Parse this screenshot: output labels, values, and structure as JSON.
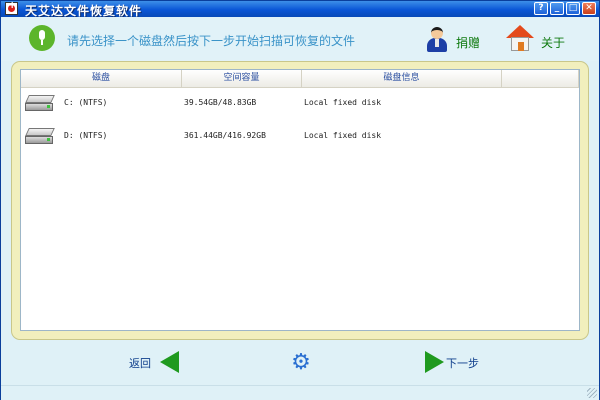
{
  "window": {
    "title": "天艾达文件恢复软件"
  },
  "title_buttons": {
    "help": "?",
    "minimize": "_",
    "maximize": "□",
    "close": "✕"
  },
  "hint": {
    "text": "请先选择一个磁盘然后按下一步开始扫描可恢复的文件",
    "icon": "mic-icon",
    "accent": "#5cb52b"
  },
  "toolbar": {
    "donate_label": "捐赠",
    "about_label": "关于",
    "label_color": "#0f7a0f"
  },
  "list": {
    "columns": [
      "磁盘",
      "空间容量",
      "磁盘信息",
      ""
    ],
    "rows": [
      {
        "drive": "C: (NTFS)",
        "space": "39.54GB/48.83GB",
        "info": "Local fixed disk",
        "icon": "hard-drive-icon"
      },
      {
        "drive": "D: (NTFS)",
        "space": "361.44GB/416.92GB",
        "info": "Local fixed disk",
        "icon": "hard-drive-icon"
      }
    ]
  },
  "nav": {
    "back_label": "返回",
    "next_label": "下一步",
    "settings_icon": "gear-icon",
    "arrow_color": "#1f9a1f"
  }
}
